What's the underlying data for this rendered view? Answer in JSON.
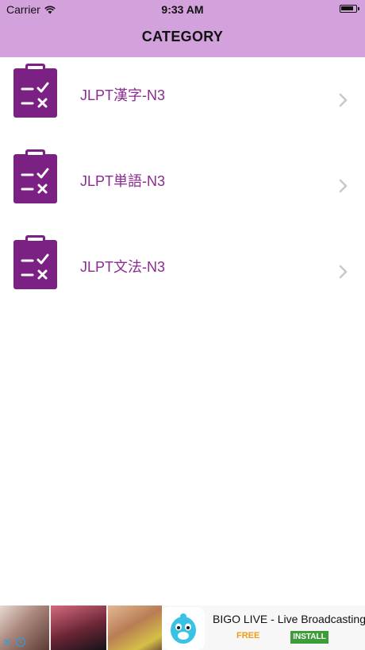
{
  "status_bar": {
    "carrier": "Carrier",
    "time": "9:33 AM"
  },
  "header": {
    "title": "CATEGORY",
    "bg_color": "#d3a1dc"
  },
  "categories": [
    {
      "label": "JLPT漢字-N3",
      "icon": "checklist-clipboard-icon"
    },
    {
      "label": "JLPT単語-N3",
      "icon": "checklist-clipboard-icon"
    },
    {
      "label": "JLPT文法-N3",
      "icon": "checklist-clipboard-icon"
    }
  ],
  "colors": {
    "accent": "#7b2183",
    "label": "#8a2c91",
    "chevron": "#c7c7cc"
  },
  "ad": {
    "title": "BIGO LIVE - Live Broadcasting",
    "price": "FREE",
    "install_label": "INSTALL",
    "close_glyph": "✕",
    "info_glyph": "i"
  }
}
